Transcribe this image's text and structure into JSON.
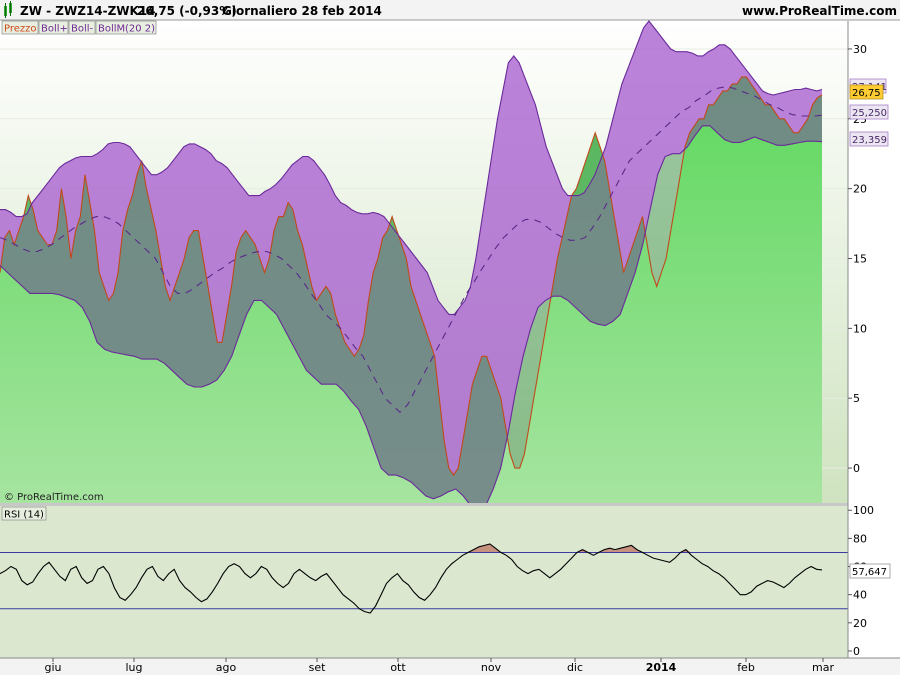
{
  "header": {
    "symbol_line": "ZW - ZWZ14-ZWK14",
    "price_change": "26,75 (-0,93%)",
    "period_date": "Giornaliero  28 feb 2014",
    "site": "www.ProRealTime.com"
  },
  "legend": {
    "price": "Prezzo",
    "bollp": "Boll+",
    "bollm_short": "Boll-",
    "bollmid": "BollM",
    "params": "(20 2)"
  },
  "copyright": "© ProRealTime.com",
  "rsi_label": "RSI (14)",
  "badges": {
    "last": "26,75",
    "upper": "27,141",
    "mid": "25,250",
    "lower": "23,359",
    "rsi": "57,647"
  },
  "colors": {
    "price_fill": "#66d966",
    "upper_band": "#9a4fc4",
    "band_fill": "#a85fd0",
    "band_fill_lower": "#4f9a5a",
    "rsi_bg": "#d8e6cc",
    "highlight": "#ffcc33"
  },
  "x_labels": [
    "giu",
    "lug",
    "ago",
    "set",
    "ott",
    "nov",
    "dic",
    "2014",
    "feb",
    "mar"
  ],
  "chart_data": [
    {
      "type": "area",
      "title": "ZW - ZWZ14-ZWK14",
      "ylim": [
        -2.5,
        32
      ],
      "yticks": [
        0,
        5,
        10,
        15,
        20,
        25,
        30
      ],
      "series": [
        {
          "name": "Prezzo",
          "values": [
            14,
            16.5,
            17,
            16,
            17,
            18,
            19.5,
            18.5,
            17,
            16.5,
            16,
            16,
            17,
            20,
            18,
            15,
            17,
            18,
            21,
            19,
            17,
            14,
            13,
            12,
            12.5,
            14,
            17,
            18.5,
            19.5,
            21,
            22,
            20,
            18.5,
            17,
            15,
            13,
            12,
            13,
            14,
            15,
            16.5,
            17,
            17,
            15,
            13,
            11,
            9,
            9,
            11,
            13,
            15.5,
            16.5,
            17,
            16.5,
            16,
            15,
            14,
            15,
            17,
            18,
            18,
            19,
            18.5,
            17,
            16,
            14.5,
            13,
            12,
            12.5,
            13,
            12.5,
            11,
            10,
            9,
            8.5,
            8,
            8.5,
            9.5,
            12,
            14,
            15,
            16.5,
            17,
            18,
            17,
            16,
            15,
            13,
            12,
            11,
            10,
            9,
            8,
            5,
            2,
            0,
            -0.5,
            0,
            2,
            4,
            6,
            7,
            8,
            8,
            7,
            6,
            5,
            3,
            1,
            0,
            0,
            1,
            3,
            5,
            7,
            9,
            11,
            13,
            15,
            16.5,
            18,
            19.5,
            20,
            21,
            22,
            23,
            24,
            23,
            22,
            20,
            18,
            16,
            14,
            15,
            16,
            17,
            18,
            16,
            14,
            13,
            14,
            15,
            17,
            19,
            21,
            23,
            24,
            24.5,
            25,
            25,
            26,
            26,
            26.5,
            27,
            27,
            27.5,
            27.5,
            28,
            28,
            27.5,
            27,
            26.5,
            26,
            26,
            25.5,
            25,
            25,
            24.5,
            24,
            24,
            24.5,
            25,
            26,
            26.5,
            26.7
          ]
        },
        {
          "name": "Boll+",
          "values": [
            18.5,
            18.5,
            18.3,
            18,
            18,
            18.2,
            19,
            19.5,
            20,
            20.5,
            21,
            21.5,
            21.8,
            22,
            22.2,
            22.3,
            22.3,
            22.3,
            22.5,
            22.8,
            23.2,
            23.3,
            23.3,
            23.2,
            23,
            22.5,
            22,
            21.5,
            21,
            21,
            21.2,
            21.5,
            22,
            22.5,
            23,
            23.2,
            23.2,
            23,
            22.8,
            22.5,
            22,
            21.8,
            21.5,
            21,
            20.5,
            20,
            19.5,
            19.5,
            19.5,
            19.8,
            20,
            20.3,
            20.7,
            21.2,
            21.7,
            22,
            22.3,
            22.3,
            22,
            21.5,
            21,
            20.3,
            19.5,
            19,
            18.8,
            18.5,
            18.3,
            18.2,
            18.2,
            18.3,
            18.2,
            18,
            17.5,
            17,
            16.5,
            16,
            15.5,
            15,
            14.5,
            14,
            13,
            12,
            11.5,
            11,
            11,
            11.5,
            12,
            13,
            15,
            17.5,
            20,
            22.5,
            25,
            27,
            29,
            29.5,
            29,
            28,
            27,
            26,
            24.5,
            23,
            22,
            21,
            20,
            19.5,
            19.5,
            19.5,
            19.7,
            20.3,
            21,
            22,
            23,
            24.5,
            26,
            27.5,
            28.5,
            29.5,
            30.5,
            31.5,
            32,
            31.5,
            31,
            30.5,
            30,
            29.8,
            29.8,
            29.8,
            29.7,
            29.5,
            29.5,
            29.8,
            30,
            30.3,
            30.3,
            30,
            29.5,
            29,
            28.5,
            28,
            27.5,
            27,
            26.8,
            26.7,
            26.8,
            26.9,
            27,
            27.1,
            27.1,
            27.2,
            27.1,
            27,
            27.1
          ]
        },
        {
          "name": "BollM",
          "values": [
            16.5,
            16.3,
            16,
            15.7,
            15.5,
            15.5,
            15.7,
            16,
            16.4,
            16.8,
            17.2,
            17.5,
            17.8,
            18,
            18,
            17.8,
            17.5,
            17,
            16.5,
            16,
            15.5,
            15,
            14,
            13,
            12.5,
            12.5,
            12.8,
            13.2,
            13.6,
            14,
            14.3,
            14.7,
            15,
            15.2,
            15.4,
            15.5,
            15.5,
            15.3,
            15,
            14.5,
            14,
            13.3,
            12.5,
            11.8,
            11,
            10.5,
            10,
            9.3,
            8.6,
            8,
            7,
            6,
            5,
            4.5,
            4,
            4.5,
            5.5,
            6.5,
            7.5,
            8.5,
            9.5,
            10.5,
            11.5,
            12.5,
            13.3,
            14.2,
            15,
            15.8,
            16.5,
            17,
            17.5,
            17.8,
            17.8,
            17.6,
            17.2,
            16.8,
            16.5,
            16.3,
            16.3,
            16.5,
            17.2,
            18,
            19,
            20,
            21,
            22,
            22.5,
            23,
            23.5,
            24,
            24.5,
            25,
            25.5,
            25.8,
            26.3,
            26.6,
            27,
            27.2,
            27.3,
            27.2,
            27,
            26.8,
            26.6,
            26.3,
            26,
            25.8,
            25.5,
            25.3,
            25.2,
            25.2,
            25.2,
            25.25
          ]
        },
        {
          "name": "Boll-",
          "values": [
            14.5,
            14,
            13.5,
            13,
            12.5,
            12.5,
            12.5,
            12.5,
            12.4,
            12.2,
            12,
            11.5,
            10.5,
            9,
            8.5,
            8.3,
            8.2,
            8.1,
            8,
            7.8,
            7.8,
            7.8,
            7.5,
            7,
            6.5,
            6,
            5.8,
            5.8,
            6,
            6.3,
            7,
            8,
            9.5,
            11,
            12,
            12,
            11.5,
            11,
            10,
            9,
            8,
            7,
            6.5,
            6,
            6,
            6,
            5.5,
            4.8,
            4.2,
            3,
            1.5,
            0,
            -0.5,
            -0.5,
            -0.7,
            -1,
            -1.5,
            -2,
            -2.2,
            -2,
            -1.7,
            -1.5,
            -2,
            -2.7,
            -3.2,
            -2.7,
            -1.5,
            0,
            2.5,
            5.5,
            8,
            10,
            11.5,
            12,
            12.3,
            12.3,
            12,
            11.5,
            11,
            10.5,
            10.3,
            10.2,
            10.5,
            11,
            12.5,
            14,
            16,
            18.5,
            21,
            22.3,
            22.5,
            22.5,
            23,
            23.8,
            24.5,
            24.5,
            24,
            23.5,
            23.3,
            23.3,
            23.5,
            23.7,
            23.5,
            23.3,
            23.1,
            23.1,
            23.2,
            23.3,
            23.4,
            23.4,
            23.36
          ]
        }
      ]
    },
    {
      "type": "line",
      "title": "RSI (14)",
      "ylim": [
        -5,
        103
      ],
      "yticks": [
        0,
        20,
        40,
        60,
        80,
        100
      ],
      "levels": [
        70,
        30
      ],
      "series": [
        {
          "name": "RSI (14)",
          "values": [
            55,
            57,
            60,
            58,
            50,
            47,
            49,
            55,
            60,
            63,
            58,
            53,
            50,
            58,
            60,
            52,
            48,
            50,
            58,
            60,
            55,
            45,
            38,
            36,
            40,
            45,
            52,
            58,
            60,
            53,
            50,
            55,
            58,
            50,
            45,
            42,
            38,
            35,
            37,
            42,
            48,
            55,
            60,
            62,
            60,
            55,
            52,
            55,
            60,
            58,
            52,
            48,
            45,
            48,
            55,
            58,
            55,
            52,
            50,
            53,
            55,
            50,
            45,
            40,
            37,
            34,
            30,
            28,
            27,
            32,
            40,
            48,
            52,
            55,
            50,
            47,
            42,
            38,
            36,
            40,
            45,
            52,
            58,
            62,
            65,
            68,
            70,
            72,
            74,
            75,
            76,
            73,
            70,
            68,
            65,
            60,
            57,
            55,
            57,
            58,
            55,
            52,
            55,
            58,
            62,
            66,
            70,
            72,
            70,
            68,
            70,
            72,
            73,
            72,
            73,
            74,
            75,
            72,
            70,
            68,
            66,
            65,
            64,
            63,
            66,
            70,
            72,
            68,
            65,
            62,
            60,
            57,
            55,
            52,
            48,
            44,
            40,
            40,
            42,
            46,
            48,
            50,
            49,
            47,
            45,
            48,
            52,
            55,
            58,
            60,
            58,
            57.6
          ]
        }
      ]
    }
  ]
}
